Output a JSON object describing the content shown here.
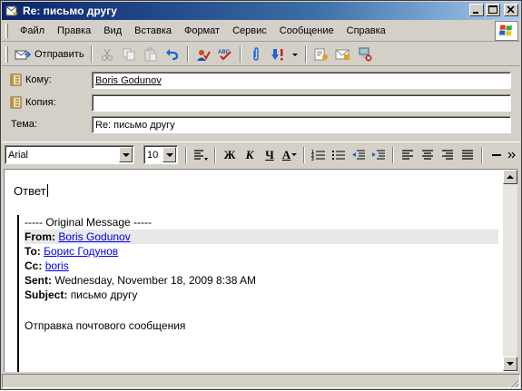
{
  "window": {
    "title": "Re: письмо другу"
  },
  "menu": {
    "items": [
      "Файл",
      "Правка",
      "Вид",
      "Вставка",
      "Формат",
      "Сервис",
      "Сообщение",
      "Справка"
    ]
  },
  "toolbar": {
    "send_label": "Отправить"
  },
  "header": {
    "to_label": "Кому:",
    "to_value": "Boris Godunov",
    "cc_label": "Копия:",
    "cc_value": "",
    "subject_label": "Тема:",
    "subject_value": "Re: письмо другу"
  },
  "format": {
    "font": "Arial",
    "size": "10",
    "bold": "Ж",
    "italic": "К",
    "underline": "Ч",
    "font_color": "A"
  },
  "body": {
    "reply": "Ответ",
    "quote_header": "----- Original Message -----",
    "from_label": "From:",
    "from_value": "Boris Godunov",
    "to_label": "To:",
    "to_value": "Борис Годунов",
    "cc_label": "Cc:",
    "cc_value": "boris",
    "sent_label": "Sent:",
    "sent_value": "Wednesday, November 18, 2009 8:38 AM",
    "subject_label": "Subject:",
    "subject_value": "письмо другу",
    "message": "Отправка почтового сообщения"
  },
  "colors": {
    "title_bar": "#0a246a",
    "chrome": "#d4d0c8",
    "link": "#0000ee"
  }
}
